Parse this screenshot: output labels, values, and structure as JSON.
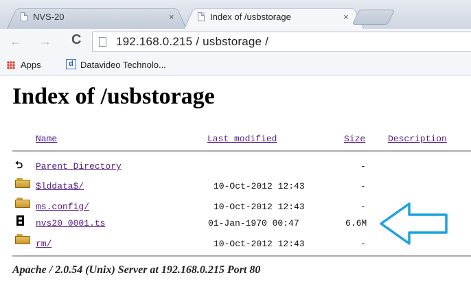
{
  "browser": {
    "tabs": [
      {
        "title": "NVS-20",
        "active": false
      },
      {
        "title": "Index of /usbstorage",
        "active": true
      }
    ],
    "close_glyph": "×",
    "nav": {
      "back": "←",
      "forward": "→",
      "reload": "C"
    },
    "address": "192.168.0.215 / usbstorage /",
    "bookmarks": {
      "apps": "Apps",
      "datavideo_icon": "d",
      "datavideo": "Datavideo Technolo..."
    }
  },
  "page": {
    "heading": "Index of /usbstorage",
    "columns": {
      "name": "Name",
      "modified": "Last modified",
      "size": "Size",
      "description": "Description"
    },
    "parent": {
      "icon": "back-icon",
      "label": "Parent Directory",
      "size": "-"
    },
    "rows": [
      {
        "icon": "folder-icon",
        "name": "$lddata$/",
        "modified": "10-Oct-2012 12:43",
        "size": "-"
      },
      {
        "icon": "folder-icon",
        "name": "ms.config/",
        "modified": "10-Oct-2012 12:43",
        "size": "-"
      },
      {
        "icon": "film-icon",
        "name": "nvs20_0001.ts",
        "modified": "01-Jan-1970 00:47",
        "size": "6.6M"
      },
      {
        "icon": "folder-icon",
        "name": "rm/",
        "modified": "10-Oct-2012 12:43",
        "size": "-"
      }
    ],
    "footer": "Apache / 2.0.54 (Unix) Server at 192.168.0.215 Port 80",
    "colors": {
      "link": "#551a8b",
      "arrow": "#1aa3e0"
    }
  }
}
